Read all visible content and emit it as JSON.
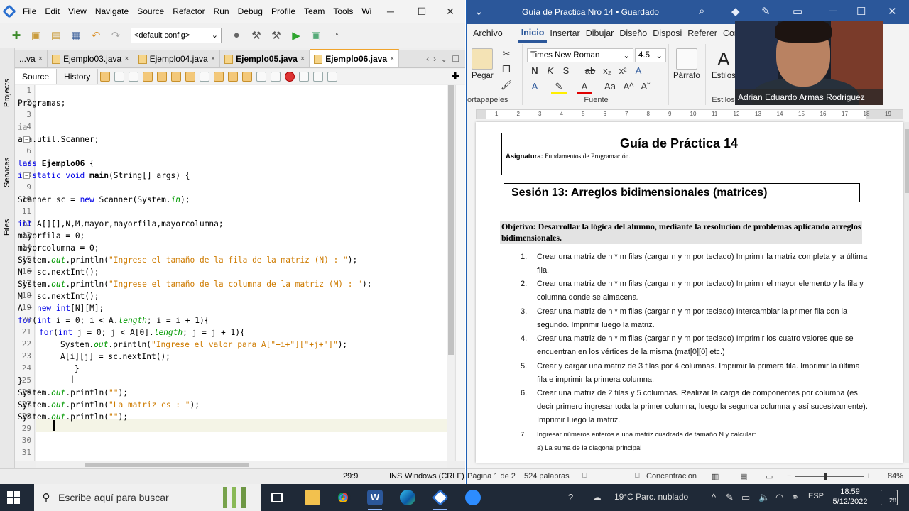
{
  "netbeans": {
    "menus": [
      "File",
      "Edit",
      "View",
      "Navigate",
      "Source",
      "Refactor",
      "Run",
      "Debug",
      "Profile",
      "Team",
      "Tools",
      "Wi"
    ],
    "config": "<default config>",
    "side_tabs": [
      "Projects",
      "Services",
      "Files"
    ],
    "file_tabs": [
      {
        "label": "...va",
        "active": false
      },
      {
        "label": "Ejemplo03.java",
        "active": false
      },
      {
        "label": "Ejemplo04.java",
        "active": false
      },
      {
        "label": "Ejemplo05.java",
        "active": false
      },
      {
        "label": "Ejemplo06.java",
        "active": true
      }
    ],
    "close_glyph": "×",
    "editor_tabs": [
      "Source",
      "History"
    ],
    "line_numbers": [
      "1",
      "2",
      "3",
      "4",
      "5",
      "6",
      "7",
      "8",
      "9",
      "10",
      "11",
      "12",
      "13",
      "14",
      "15",
      "16",
      "17",
      "18",
      "19",
      "20",
      "21",
      "22",
      "23",
      "24",
      "25",
      "26",
      "27",
      "28",
      "29",
      "30",
      "31"
    ],
    "code": {
      "l2": "Programas;",
      "l4": "ia",
      "l5": "ava.util.Scanner;",
      "l7a": "lass ",
      "l7b": "Ejemplo06",
      "l7c": " {",
      "l8a": "ic static void ",
      "l8b": "main",
      "l8c": "(String[] args) {",
      "l10a": "Scanner sc = ",
      "l10b": "new",
      "l10c": " Scanner(System.",
      "l10d": "in",
      "l10e": ");",
      "l12a": "int",
      "l12b": " A[][],N,M,mayor,mayorfila,mayorcolumna;",
      "l13": "mayorfila = 0;",
      "l14": "mayorcolumna = 0;",
      "l15a": "System.",
      "l15b": "out",
      "l15c": ".println(",
      "l15d": "\"Ingrese el tamaño de la fila de la matriz (N) : \"",
      "l15e": ");",
      "l16": "N = sc.nextInt();",
      "l17a": "System.",
      "l17b": "out",
      "l17c": ".println(",
      "l17d": "\"Ingrese el tamaño de la columna de la matriz (M) : \"",
      "l17e": ");",
      "l18": "M = sc.nextInt();",
      "l19a": "A = ",
      "l19b": "new",
      "l19c": " ",
      "l19d": "int",
      "l19e": "[N][M];",
      "l20a": "for",
      "l20b": "(",
      "l20c": "int",
      "l20d": " i = 0; i < A.",
      "l20e": "length",
      "l20f": "; i = i + 1){",
      "l21a": "for",
      "l21b": "(",
      "l21c": "int",
      "l21d": " j = 0; j < A[0].",
      "l21e": "length",
      "l21f": "; j = j + 1){",
      "l22a": "System.",
      "l22b": "out",
      "l22c": ".println(",
      "l22d": "\"Ingrese el valor para A[\"+i+\"][\"+j+\"]\"",
      "l22e": ");",
      "l23": "A[i][j] = sc.nextInt();",
      "l24": "}",
      "l25": "}",
      "l26a": "System.",
      "l26b": "out",
      "l26c": ".println(",
      "l26d": "\"\"",
      "l26e": ");",
      "l27a": "System.",
      "l27b": "out",
      "l27c": ".println(",
      "l27d": "\"La matriz es : \"",
      "l27e": ");",
      "l28a": "System.",
      "l28b": "out",
      "l28c": ".println(",
      "l28d": "\"\"",
      "l28e": ");"
    },
    "status": {
      "position": "29:9",
      "mode": "INS",
      "line_ending": "Windows (CRLF)"
    }
  },
  "word": {
    "title": "Guía de Practica Nro 14 • Guardado",
    "tabs": [
      "Archivo",
      "Inicio",
      "Insertar",
      "Dibujar",
      "Diseño",
      "Disposi",
      "Referer",
      "Corres"
    ],
    "ribbon": {
      "paste": "Pegar",
      "clipboard": "ortapapeles",
      "font_name": "Times New Roman",
      "font_size": "4.5",
      "font_group": "Fuente",
      "paragraph": "Párrafo",
      "styles": "Estilos",
      "styles_group": "Estilos"
    },
    "ruler_nums": [
      "1",
      "2",
      "3",
      "4",
      "5",
      "6",
      "7",
      "8",
      "9",
      "10",
      "11",
      "12",
      "13",
      "14",
      "15",
      "16",
      "17",
      "18",
      "19"
    ],
    "doc": {
      "title": "Guía de Práctica 14",
      "subject_label": "Asignatura:",
      "subject_value": "Fundamentos de Programación.",
      "session": "Sesión 13: Arreglos bidimensionales (matrices)",
      "objective": "Objetivo: Desarrollar la lógica del alumno, mediante la resolución de problemas aplicando arreglos bidimensionales.",
      "exercises": [
        {
          "n": "1.",
          "text": "Crear una matriz de n * m filas (cargar n y m por teclado) Imprimir la matriz completa y la última fila."
        },
        {
          "n": "2.",
          "text": "Crear una matriz de n * m filas (cargar n y m por teclado) Imprimir el mayor elemento y la fila y columna donde se almacena."
        },
        {
          "n": "3.",
          "text": "Crear una matriz de n * m filas (cargar n y m por teclado) Intercambiar la primer fila con la segundo. Imprimir luego la matriz."
        },
        {
          "n": "4.",
          "text": "Crear una matriz de n * m filas (cargar n y m por teclado) Imprimir los cuatro valores que se encuentran en los vértices de la misma (mat[0][0] etc.)"
        },
        {
          "n": "5.",
          "text": "Crear y cargar una matriz de 3 filas por 4 columnas. Imprimir la primera fila. Imprimir la última fila e imprimir la primera columna."
        },
        {
          "n": "6.",
          "text": "Crear una matriz de 2 filas y 5 columnas. Realizar la carga de componentes por columna (es decir primero ingresar toda la primer columna, luego la segunda columna y así sucesivamente). Imprimir luego la matriz."
        },
        {
          "n": "7.",
          "text": "Ingresar números enteros a una matriz cuadrada de tamaño N y calcular:"
        }
      ],
      "sub_item": "a) La suma de la diagonal principal"
    },
    "status": {
      "page": "Página 1 de 2",
      "words": "524 palabras",
      "focus": "Concentración",
      "zoom": "84%"
    }
  },
  "webcam": {
    "name": "Adrian Eduardo Armas Rodriguez"
  },
  "taskbar": {
    "search_placeholder": "Escribe aquí para buscar",
    "weather": "19°C  Parc. nublado",
    "lang": "ESP",
    "time": "18:59",
    "date": "5/12/2022",
    "notifications": "28"
  }
}
